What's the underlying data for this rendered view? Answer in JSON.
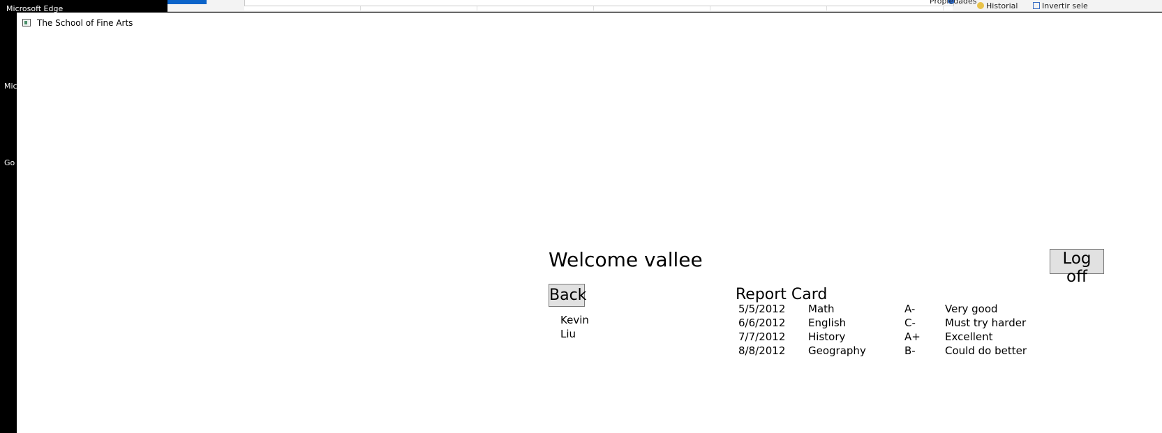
{
  "background": {
    "edge_label": "Microsoft Edge",
    "left_labels": [
      "Mic",
      "Go"
    ],
    "ribbon": {
      "propiedades": "Propiedades",
      "historial": "Historial",
      "invertir": "Invertir sele"
    }
  },
  "window": {
    "title": "The School of Fine Arts"
  },
  "page": {
    "welcome": "Welcome vallee",
    "logoff_label": "Log off",
    "back_label": "Back",
    "student_first": "Kevin",
    "student_last": "Liu"
  },
  "report_card": {
    "title": "Report Card",
    "rows": [
      {
        "date": "5/5/2012",
        "subject": "Math",
        "grade": "A-",
        "comment": "Very good"
      },
      {
        "date": "6/6/2012",
        "subject": "English",
        "grade": "C-",
        "comment": "Must try harder"
      },
      {
        "date": "7/7/2012",
        "subject": "History",
        "grade": "A+",
        "comment": "Excellent"
      },
      {
        "date": "8/8/2012",
        "subject": "Geography",
        "grade": "B-",
        "comment": "Could do better"
      }
    ]
  }
}
